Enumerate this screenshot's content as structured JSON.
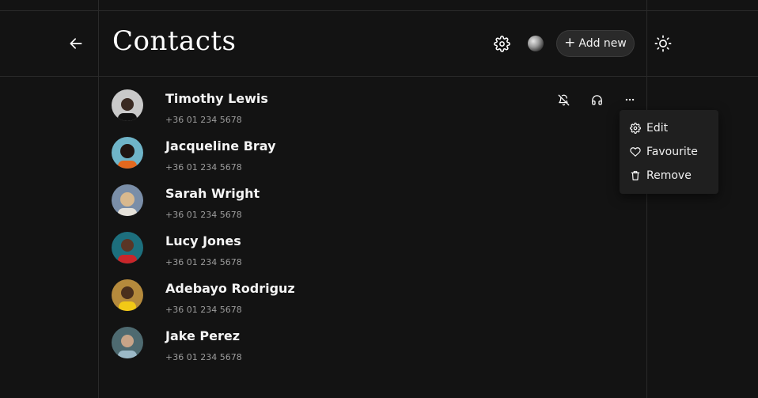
{
  "header": {
    "title": "Contacts",
    "add_label": "Add new"
  },
  "icons": {
    "back": "arrow-left-icon",
    "settings": "gear-icon",
    "theme": "sun-icon",
    "add": "plus-icon",
    "mute": "bell-off-icon",
    "call": "headphones-icon",
    "more": "more-dots-icon"
  },
  "contacts": [
    {
      "name": "Timothy Lewis",
      "phone": "+36 01 234 5678",
      "avatar_bg": "#c9c9c9",
      "avatar_fg": "#3a2a22",
      "avatar_shirt": "#101010"
    },
    {
      "name": "Jacqueline Bray",
      "phone": "+36 01 234 5678",
      "avatar_bg": "#6fb4c8",
      "avatar_fg": "#1f1512",
      "avatar_shirt": "#e2681e"
    },
    {
      "name": "Sarah Wright",
      "phone": "+36 01 234 5678",
      "avatar_bg": "#7a8ea8",
      "avatar_fg": "#d9b98e",
      "avatar_shirt": "#e6e2da"
    },
    {
      "name": "Lucy Jones",
      "phone": "+36 01 234 5678",
      "avatar_bg": "#1d6f7d",
      "avatar_fg": "#5a3526",
      "avatar_shirt": "#c9262a"
    },
    {
      "name": "Adebayo Rodriguz",
      "phone": "+36 01 234 5678",
      "avatar_bg": "#b58a3c",
      "avatar_fg": "#4a2f1c",
      "avatar_shirt": "#f2c916"
    },
    {
      "name": "Jake Perez",
      "phone": "+36 01 234 5678",
      "avatar_bg": "#4e6a70",
      "avatar_fg": "#c7a488",
      "avatar_shirt": "#9cb9c7"
    }
  ],
  "menu": {
    "items": [
      {
        "label": "Edit",
        "icon": "gear-icon"
      },
      {
        "label": "Favourite",
        "icon": "heart-icon"
      },
      {
        "label": "Remove",
        "icon": "trash-icon"
      }
    ]
  },
  "colors": {
    "background": "#131313",
    "divider": "#2a2a2a",
    "button_bg": "#2a2a2a",
    "menu_bg": "#1f1f1f",
    "text": "#f2f2f2",
    "muted_text": "#9c9c9c"
  }
}
